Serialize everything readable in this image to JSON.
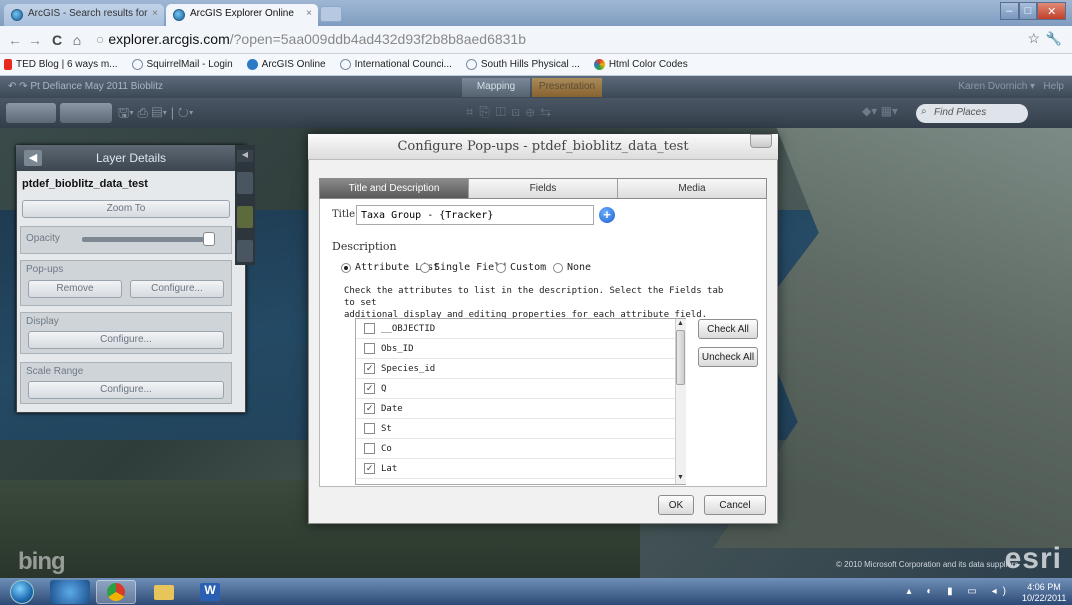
{
  "browser": {
    "tabs": [
      {
        "label": "ArcGIS - Search results for",
        "active": false
      },
      {
        "label": "ArcGIS Explorer Online",
        "active": true
      }
    ],
    "url_host": "explorer.arcgis.com",
    "url_path": "/?open=5aa009ddb4ad432d93f2b8b8aed6831b",
    "bookmarks": [
      {
        "label": "TED Blog | 6 ways m...",
        "icon": "ted-icon",
        "color": "#e62b1e"
      },
      {
        "label": "SquirrelMail - Login",
        "icon": "globe-icon",
        "color": "#7a8ea3"
      },
      {
        "label": "ArcGIS Online",
        "icon": "arcgis-icon",
        "color": "#2a7ac4"
      },
      {
        "label": "International Counci...",
        "icon": "globe-icon",
        "color": "#7a8ea3"
      },
      {
        "label": "South Hills Physical ...",
        "icon": "globe-icon",
        "color": "#7a8ea3"
      },
      {
        "label": "Html Color Codes",
        "icon": "color-codes-icon",
        "color": "#d93b2b"
      }
    ]
  },
  "app": {
    "title": "Pt Defiance May 2011 Bioblitz",
    "tabs": [
      "Mapping",
      "Presentation"
    ],
    "user": "Karen Dvornich",
    "help": "Help",
    "find_placeholder": "Find Places"
  },
  "map": {
    "bing": "bing",
    "esri": "esri",
    "copyright": "© 2010 Microsoft Corporation and its data suppliers"
  },
  "layer_panel": {
    "header": "Layer Details",
    "layer_name": "ptdef_bioblitz_data_test",
    "zoom_to": "Zoom To",
    "opacity_label": "Opacity",
    "opacity_value": 0.95,
    "popups_label": "Pop-ups",
    "remove": "Remove",
    "configure": "Configure...",
    "display_label": "Display",
    "display_configure": "Configure...",
    "scale_label": "Scale Range",
    "scale_configure": "Configure..."
  },
  "dialog": {
    "title": "Configure Pop-ups - ptdef_bioblitz_data_test",
    "tabs": [
      "Title and Description",
      "Fields",
      "Media"
    ],
    "title_label": "Title",
    "title_value": "Taxa Group - {Tracker}",
    "description_label": "Description",
    "description_options": [
      "Attribute List",
      "Single Field",
      "Custom",
      "None"
    ],
    "selected_option": "Attribute List",
    "instructions_line1": "Check the attributes to list in the description. Select the Fields tab to set",
    "instructions_line2": "additional display and editing properties for each attribute field.",
    "attributes": [
      {
        "name": "__OBJECTID",
        "checked": false
      },
      {
        "name": "Obs_ID",
        "checked": false
      },
      {
        "name": "Species_id",
        "checked": true
      },
      {
        "name": "Q",
        "checked": true
      },
      {
        "name": "Date",
        "checked": true
      },
      {
        "name": "St",
        "checked": false
      },
      {
        "name": "Co",
        "checked": false
      },
      {
        "name": "Lat",
        "checked": true
      }
    ],
    "check_all": "Check All",
    "uncheck_all": "Uncheck All",
    "ok": "OK",
    "cancel": "Cancel"
  },
  "taskbar": {
    "time": "4:06 PM",
    "date": "10/22/2011",
    "word_label": "W"
  }
}
